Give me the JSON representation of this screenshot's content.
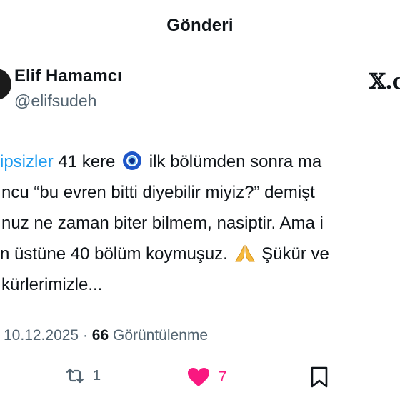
{
  "header": {
    "title": "Gönderi"
  },
  "author": {
    "name": "Elif Hamamcı",
    "handle": "@elifsudeh",
    "platform_logo": "𝕏.c"
  },
  "post": {
    "line1": {
      "hashtag": "ipsizler",
      "after_hashtag": " 41 kere",
      "emoji": "evil-eye-icon",
      "after_emoji": " ilk bölümden sonra ma"
    },
    "line2": "ncu “bu evren bitti diyebilir miyiz?” demişt",
    "line3": "nuz ne zaman biter bilmem, nasiptir. Ama i",
    "line4": {
      "before_emoji": "n üstüne 40 bölüm koymuşuz. ",
      "emoji": "folded-hands-icon",
      "after_emoji": " Şükür ve"
    },
    "line5": "kürlerimizle..."
  },
  "meta": {
    "date": "10.12.2025",
    "separator": " · ",
    "views_count": "66",
    "views_label": "Görüntülenme"
  },
  "actions": {
    "repost_count": "1",
    "like_count": "7",
    "liked": true,
    "colors": {
      "like": "#f91880",
      "muted": "#536471",
      "link": "#1d9bf0"
    }
  }
}
